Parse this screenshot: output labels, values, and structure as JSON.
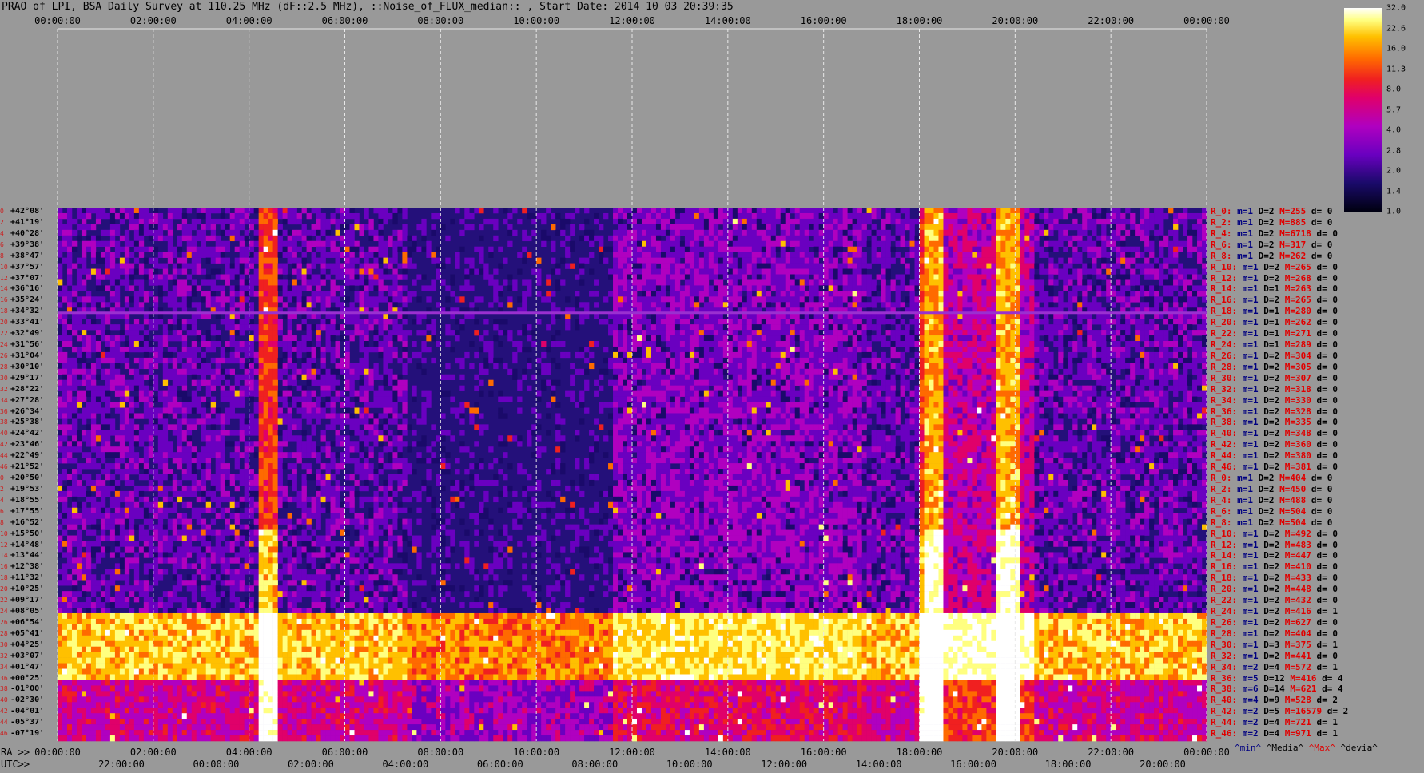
{
  "title": "PRAO of LPI, BSA Daily Survey at 110.25 MHz (dF::2.5 MHz), ::Noise_of_FLUX_median:: , Start Date: 2014 10 03 20:39:35",
  "axes": {
    "top_ticks": [
      "00:00:00",
      "02:00:00",
      "04:00:00",
      "06:00:00",
      "08:00:00",
      "10:00:00",
      "12:00:00",
      "14:00:00",
      "16:00:00",
      "18:00:00",
      "20:00:00",
      "22:00:00",
      "00:00:00"
    ],
    "ra_prefix": "RA >>",
    "ra_ticks": [
      "00:00:00",
      "02:00:00",
      "04:00:00",
      "06:00:00",
      "08:00:00",
      "10:00:00",
      "12:00:00",
      "14:00:00",
      "16:00:00",
      "18:00:00",
      "20:00:00",
      "22:00:00",
      "00:00:00"
    ],
    "utc_prefix": "UTC>>",
    "utc_ticks": [
      "22:00:00",
      "00:00:00",
      "02:00:00",
      "04:00:00",
      "06:00:00",
      "08:00:00",
      "10:00:00",
      "12:00:00",
      "14:00:00",
      "16:00:00",
      "18:00:00",
      "20:00:00"
    ]
  },
  "declinations": [
    "+42°08'",
    "+41°19'",
    "+40°28'",
    "+39°38'",
    "+38°47'",
    "+37°57'",
    "+37°07'",
    "+36°16'",
    "+35°24'",
    "+34°32'",
    "+33°41'",
    "+32°49'",
    "+31°56'",
    "+31°04'",
    "+30°10'",
    "+29°17'",
    "+28°22'",
    "+27°28'",
    "+26°34'",
    "+25°38'",
    "+24°42'",
    "+23°46'",
    "+22°49'",
    "+21°52'",
    "+20°50'",
    "+19°53'",
    "+18°55'",
    "+17°55'",
    "+16°52'",
    "+15°50'",
    "+14°48'",
    "+13°44'",
    "+12°38'",
    "+11°32'",
    "+10°25'",
    "+09°17'",
    "+08°05'",
    "+06°54'",
    "+05°41'",
    "+04°25'",
    "+03°07'",
    "+01°47'",
    "+00°25'",
    "-01°00'",
    "-02°30'",
    "-04°01'",
    "-05°37'",
    "-07°19'"
  ],
  "row_indices": [
    "0",
    "2",
    "4",
    "6",
    "8",
    "10",
    "12",
    "14",
    "16",
    "18",
    "20",
    "22",
    "24",
    "26",
    "28",
    "30",
    "32",
    "34",
    "36",
    "38",
    "40",
    "42",
    "44",
    "46",
    "0",
    "2",
    "4",
    "6",
    "8",
    "10",
    "12",
    "14",
    "16",
    "18",
    "20",
    "22",
    "24",
    "26",
    "28",
    "30",
    "32",
    "34",
    "36",
    "38",
    "40",
    "42",
    "44",
    "46"
  ],
  "stats": [
    {
      "r": "R_0:",
      "m": "m=1",
      "D": "D=2",
      "M": "M=255",
      "d": "d= 0"
    },
    {
      "r": "R_2:",
      "m": "m=1",
      "D": "D=2",
      "M": "M=885",
      "d": "d= 0"
    },
    {
      "r": "R_4:",
      "m": "m=1",
      "D": "D=2",
      "M": "M=6718",
      "d": "d= 0"
    },
    {
      "r": "R_6:",
      "m": "m=1",
      "D": "D=2",
      "M": "M=317",
      "d": "d= 0"
    },
    {
      "r": "R_8:",
      "m": "m=1",
      "D": "D=2",
      "M": "M=262",
      "d": "d= 0"
    },
    {
      "r": "R_10:",
      "m": "m=1",
      "D": "D=2",
      "M": "M=265",
      "d": "d= 0"
    },
    {
      "r": "R_12:",
      "m": "m=1",
      "D": "D=2",
      "M": "M=268",
      "d": "d= 0"
    },
    {
      "r": "R_14:",
      "m": "m=1",
      "D": "D=1",
      "M": "M=263",
      "d": "d= 0"
    },
    {
      "r": "R_16:",
      "m": "m=1",
      "D": "D=2",
      "M": "M=265",
      "d": "d= 0"
    },
    {
      "r": "R_18:",
      "m": "m=1",
      "D": "D=1",
      "M": "M=280",
      "d": "d= 0"
    },
    {
      "r": "R_20:",
      "m": "m=1",
      "D": "D=1",
      "M": "M=262",
      "d": "d= 0"
    },
    {
      "r": "R_22:",
      "m": "m=1",
      "D": "D=1",
      "M": "M=271",
      "d": "d= 0"
    },
    {
      "r": "R_24:",
      "m": "m=1",
      "D": "D=1",
      "M": "M=289",
      "d": "d= 0"
    },
    {
      "r": "R_26:",
      "m": "m=1",
      "D": "D=2",
      "M": "M=304",
      "d": "d= 0"
    },
    {
      "r": "R_28:",
      "m": "m=1",
      "D": "D=2",
      "M": "M=305",
      "d": "d= 0"
    },
    {
      "r": "R_30:",
      "m": "m=1",
      "D": "D=2",
      "M": "M=307",
      "d": "d= 0"
    },
    {
      "r": "R_32:",
      "m": "m=1",
      "D": "D=2",
      "M": "M=318",
      "d": "d= 0"
    },
    {
      "r": "R_34:",
      "m": "m=1",
      "D": "D=2",
      "M": "M=330",
      "d": "d= 0"
    },
    {
      "r": "R_36:",
      "m": "m=1",
      "D": "D=2",
      "M": "M=328",
      "d": "d= 0"
    },
    {
      "r": "R_38:",
      "m": "m=1",
      "D": "D=2",
      "M": "M=335",
      "d": "d= 0"
    },
    {
      "r": "R_40:",
      "m": "m=1",
      "D": "D=2",
      "M": "M=348",
      "d": "d= 0"
    },
    {
      "r": "R_42:",
      "m": "m=1",
      "D": "D=2",
      "M": "M=360",
      "d": "d= 0"
    },
    {
      "r": "R_44:",
      "m": "m=1",
      "D": "D=2",
      "M": "M=380",
      "d": "d= 0"
    },
    {
      "r": "R_46:",
      "m": "m=1",
      "D": "D=2",
      "M": "M=381",
      "d": "d= 0"
    },
    {
      "r": "R_0:",
      "m": "m=1",
      "D": "D=2",
      "M": "M=404",
      "d": "d= 0"
    },
    {
      "r": "R_2:",
      "m": "m=1",
      "D": "D=2",
      "M": "M=450",
      "d": "d= 0"
    },
    {
      "r": "R_4:",
      "m": "m=1",
      "D": "D=2",
      "M": "M=488",
      "d": "d= 0"
    },
    {
      "r": "R_6:",
      "m": "m=1",
      "D": "D=2",
      "M": "M=504",
      "d": "d= 0"
    },
    {
      "r": "R_8:",
      "m": "m=1",
      "D": "D=2",
      "M": "M=504",
      "d": "d= 0"
    },
    {
      "r": "R_10:",
      "m": "m=1",
      "D": "D=2",
      "M": "M=492",
      "d": "d= 0"
    },
    {
      "r": "R_12:",
      "m": "m=1",
      "D": "D=2",
      "M": "M=483",
      "d": "d= 0"
    },
    {
      "r": "R_14:",
      "m": "m=1",
      "D": "D=2",
      "M": "M=447",
      "d": "d= 0"
    },
    {
      "r": "R_16:",
      "m": "m=1",
      "D": "D=2",
      "M": "M=410",
      "d": "d= 0"
    },
    {
      "r": "R_18:",
      "m": "m=1",
      "D": "D=2",
      "M": "M=433",
      "d": "d= 0"
    },
    {
      "r": "R_20:",
      "m": "m=1",
      "D": "D=2",
      "M": "M=448",
      "d": "d= 0"
    },
    {
      "r": "R_22:",
      "m": "m=1",
      "D": "D=2",
      "M": "M=432",
      "d": "d= 0"
    },
    {
      "r": "R_24:",
      "m": "m=1",
      "D": "D=2",
      "M": "M=416",
      "d": "d= 1"
    },
    {
      "r": "R_26:",
      "m": "m=1",
      "D": "D=2",
      "M": "M=627",
      "d": "d= 0"
    },
    {
      "r": "R_28:",
      "m": "m=1",
      "D": "D=2",
      "M": "M=404",
      "d": "d= 0"
    },
    {
      "r": "R_30:",
      "m": "m=1",
      "D": "D=3",
      "M": "M=375",
      "d": "d= 1"
    },
    {
      "r": "R_32:",
      "m": "m=1",
      "D": "D=2",
      "M": "M=441",
      "d": "d= 0"
    },
    {
      "r": "R_34:",
      "m": "m=2",
      "D": "D=4",
      "M": "M=572",
      "d": "d= 1"
    },
    {
      "r": "R_36:",
      "m": "m=5",
      "D": "D=12",
      "M": "M=416",
      "d": "d= 4"
    },
    {
      "r": "R_38:",
      "m": "m=6",
      "D": "D=14",
      "M": "M=621",
      "d": "d= 4"
    },
    {
      "r": "R_40:",
      "m": "m=4",
      "D": "D=9",
      "M": "M=528",
      "d": "d= 2"
    },
    {
      "r": "R_42:",
      "m": "m=2",
      "D": "D=5",
      "M": "M=16579",
      "d": "d= 2"
    },
    {
      "r": "R_44:",
      "m": "m=2",
      "D": "D=4",
      "M": "M=721",
      "d": "d= 1"
    },
    {
      "r": "R_46:",
      "m": "m=2",
      "D": "D=4",
      "M": "M=971",
      "d": "d= 1"
    }
  ],
  "legend_bottom": {
    "min": "^min^",
    "median": "^Media^",
    "max": "^Max^",
    "dev": "^devia^"
  },
  "colorbar": {
    "labels": [
      "32.0",
      "22.6",
      "16.0",
      "11.3",
      "8.0",
      "5.7",
      "4.0",
      "2.8",
      "2.0",
      "1.4",
      "1.0"
    ],
    "colors": [
      "#000010",
      "#1a0a6a",
      "#6a00c0",
      "#b000c0",
      "#e0006a",
      "#f02020",
      "#ff6a00",
      "#ffc000",
      "#ffff80",
      "#ffffff"
    ]
  },
  "chart_data": {
    "type": "heatmap",
    "title": "PRAO of LPI, BSA Daily Survey at 110.25 MHz (dF::2.5 MHz), ::Noise_of_FLUX_median:: , Start Date: 2014 10 03 20:39:35",
    "x_axis": "RA / UTC",
    "y_axis": "Declination",
    "scale": "log",
    "value_range": [
      1.0,
      32.0
    ],
    "grid": true,
    "bright_columns_ra": [
      "04:35",
      "18:15",
      "19:30"
    ],
    "bright_band_declinations": [
      "+01°47'",
      "-07°19'"
    ]
  }
}
